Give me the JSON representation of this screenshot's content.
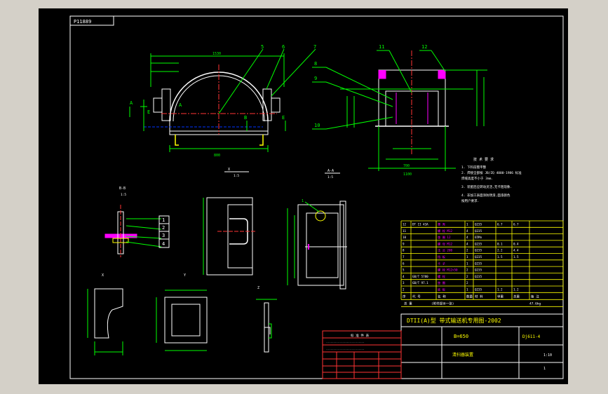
{
  "app": {
    "background_color": "#d4d0c8",
    "viewport_color": "#000000"
  },
  "drawing": {
    "colors": {
      "border": "#ffffff",
      "part": "#ffffff",
      "dim": "#00ff00",
      "center": "#ff3333",
      "title": "#ffff00",
      "accent": "#ff00ff",
      "hidden": "#0033ff"
    },
    "stamp": "P11889",
    "balloons": [
      "5",
      "6",
      "7",
      "8",
      "9",
      "10",
      "11",
      "12"
    ],
    "section_labels": {
      "view_a": "A",
      "view_b": "B",
      "view_e": "E",
      "section_aa": "A-A",
      "section_bb": "B-B",
      "scale_1_5": "1:5",
      "detail_x": "X",
      "detail_y": "Y",
      "detail_z": "Z"
    },
    "dims": {
      "main_width": "1530",
      "inner_width": "800",
      "right_width": "1100",
      "right_total": "700",
      "detail_width": "110",
      "detail_height": "620"
    },
    "callouts_left": [
      "1",
      "2",
      "3",
      "4"
    ],
    "tech_notes": {
      "title": "技 术 要 求",
      "lines": [
        "1. 下料前需平整",
        "2. 焊接全部按 JB/ZQ 4000-1986 标准",
        "   焊缝高度不小于 3mm.",
        "3. 装配后应转动灵活,无卡阻现象.",
        "4. 非加工表面涂防锈漆,面漆颜色",
        "   按用户要求."
      ]
    },
    "bom": {
      "headers": [
        "序",
        "代 号",
        "名 称",
        "数量",
        "材 料",
        "单重",
        "总重",
        "备 注"
      ],
      "rows": [
        [
          "12",
          "DT II 43A",
          "罩 壳",
          "1",
          "Q235",
          "6.7",
          "6.7",
          ""
        ],
        [
          "11",
          "",
          "螺 栓 M12",
          "4",
          "Q235",
          "",
          "",
          ""
        ],
        [
          "10",
          "",
          "垫 圈 12",
          "4",
          "65Mn",
          "",
          "",
          ""
        ],
        [
          "9",
          "",
          "螺 母 M12",
          "4",
          "Q235",
          "0.1",
          "0.4",
          ""
        ],
        [
          "8",
          "",
          "法 兰 200",
          "2",
          "Q235",
          "2.2",
          "4.4",
          ""
        ],
        [
          "7",
          "",
          "挡 板",
          "1",
          "Q235",
          "1.5",
          "1.5",
          ""
        ],
        [
          "6",
          "",
          "卡 子",
          "1",
          "Q235",
          "",
          "",
          ""
        ],
        [
          "5",
          "",
          "螺 栓 M12×50",
          "2",
          "Q235",
          "",
          "",
          ""
        ],
        [
          "4",
          "GB/T 5780",
          "螺 栓",
          "2",
          "Q235",
          "",
          "",
          ""
        ],
        [
          "3",
          "GB/T 97.1",
          "垫 圈",
          "2",
          "",
          "",
          "",
          ""
        ],
        [
          "2",
          "",
          "底 板",
          "1",
          "Q235",
          "1.2",
          "1.2",
          ""
        ]
      ],
      "footer_left": "总 重",
      "footer_mid": "(附件提示一张)",
      "footer_weight": "47.6kg"
    },
    "title_block": {
      "project": "DTII(A)型 带式输送机专用图-2002",
      "belt_width": "B=650",
      "drawing_number": "Dj611-4",
      "drawing_name": "清扫器装置",
      "scale": "1:10",
      "sheet": "1"
    },
    "small_table_title": "标 准 件 表"
  }
}
